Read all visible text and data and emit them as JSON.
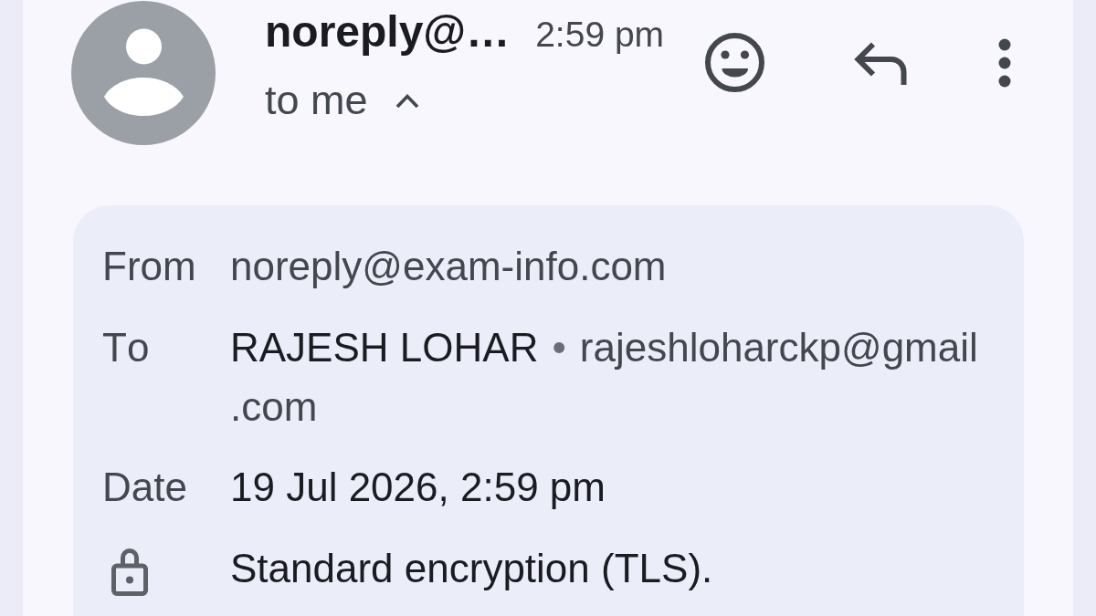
{
  "header": {
    "sender": "noreply@…",
    "time": "2:59 pm",
    "recipients": {
      "label": "to me",
      "expanded": true
    }
  },
  "details": [
    {
      "kind": "address",
      "label": "From",
      "value": "noreply@exam-info.com"
    },
    {
      "kind": "recipient",
      "label": "To",
      "name": "RAJESH LOHAR",
      "separator": "•",
      "email": "rajeshloharckp@gmail.com"
    },
    {
      "kind": "text",
      "label": "Date",
      "value": "19 Jul 2026, 2:59 pm"
    },
    {
      "kind": "security",
      "value": "Standard encryption (TLS)."
    }
  ]
}
